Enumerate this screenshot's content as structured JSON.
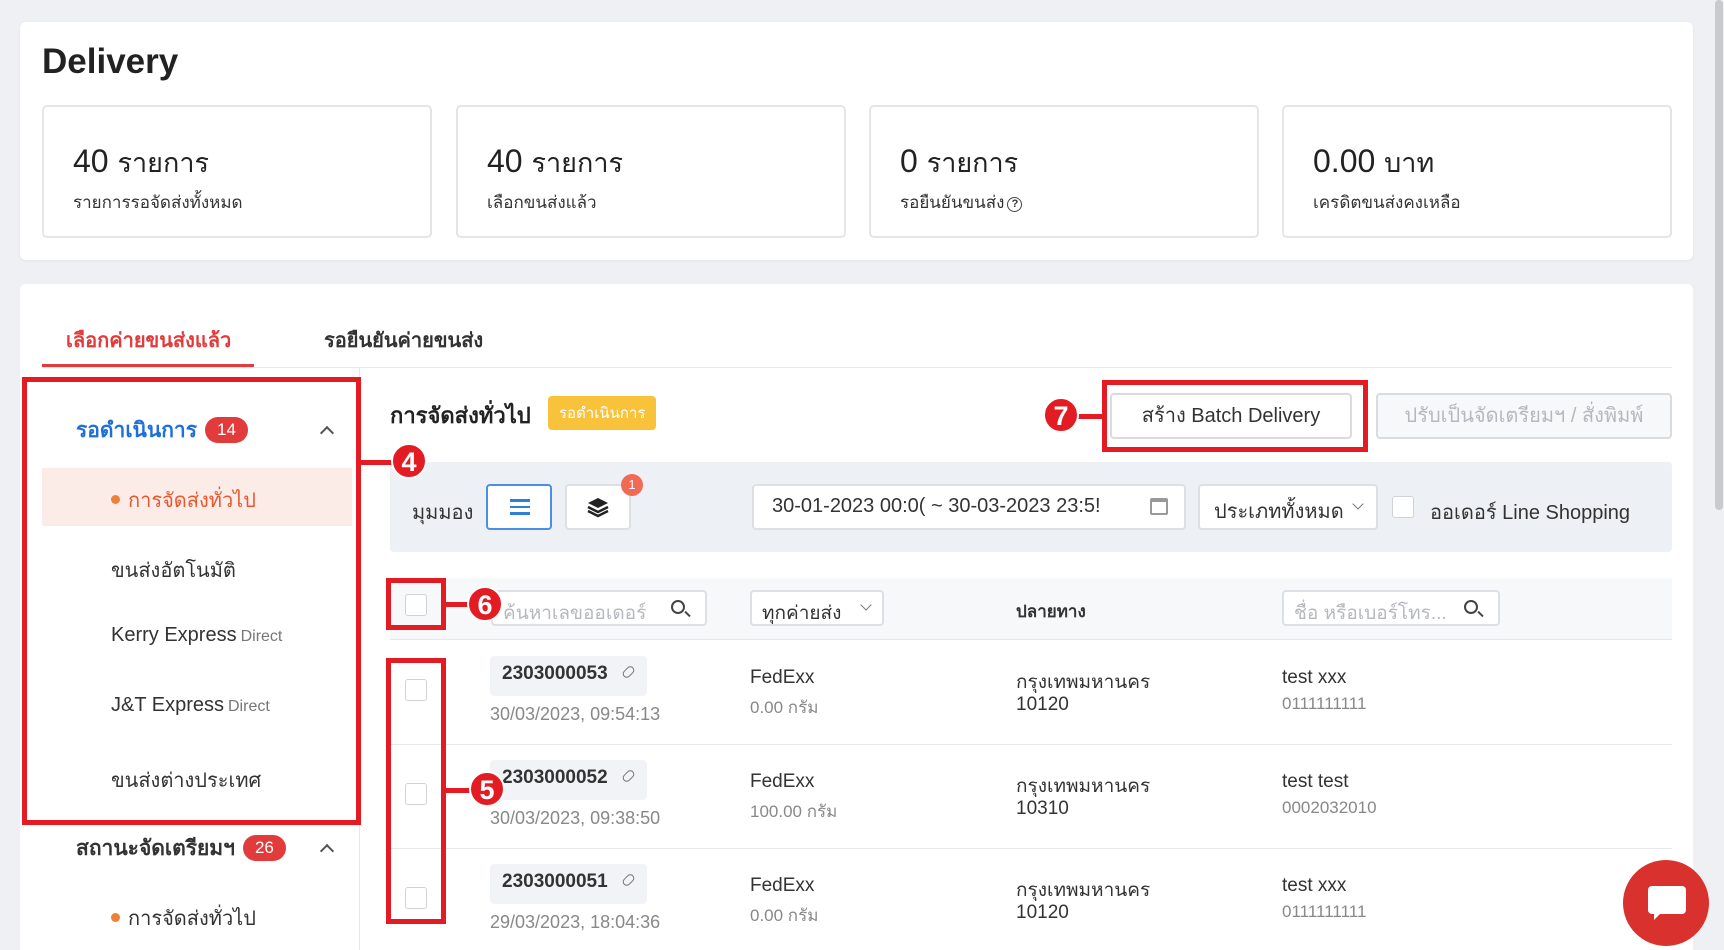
{
  "page": {
    "title": "Delivery"
  },
  "stats": [
    {
      "value": "40",
      "unit": "รายการ",
      "label": "รายการรอจัดส่งทั้งหมด"
    },
    {
      "value": "40",
      "unit": "รายการ",
      "label": "เลือกขนส่งแล้ว"
    },
    {
      "value": "0",
      "unit": "รายการ",
      "label": "รอยืนยันขนส่ง"
    },
    {
      "value": "0.00",
      "unit": "บาท",
      "label": "เครดิตขนส่งคงเหลือ"
    }
  ],
  "tabs": [
    {
      "label": "เลือกค่ายขนส่งแล้ว",
      "active": true
    },
    {
      "label": "รอยืนยันค่ายขนส่ง",
      "active": false
    }
  ],
  "sidebar": {
    "group1": {
      "label": "รอดำเนินการ",
      "count": "14"
    },
    "items": [
      {
        "label": "การจัดส่งทั่วไป",
        "active": true
      },
      {
        "label": "ขนส่งอัตโนมัติ"
      },
      {
        "label": "Kerry Express",
        "suffix": "Direct"
      },
      {
        "label": "J&T Express",
        "suffix": "Direct"
      },
      {
        "label": "ขนส่งต่างประเทศ"
      }
    ],
    "group2": {
      "label": "สถานะจัดเตรียมฯ",
      "count": "26"
    },
    "group2_items": [
      {
        "label": "การจัดส่งทั่วไป"
      }
    ]
  },
  "section": {
    "title": "การจัดส่งทั่วไป",
    "status_badge": "รอดำเนินการ",
    "batch_button": "สร้าง Batch Delivery",
    "adjust_button": "ปรับเป็นจัดเตรียมฯ / สั่งพิมพ์"
  },
  "filters": {
    "view_label": "มุมมอง",
    "layer_notification": "1",
    "date_range": "30-01-2023 00:0( ~ 30-03-2023 23:5!",
    "type_select": "ประเภททั้งหมด",
    "line_shopping_label": "ออเดอร์ Line Shopping"
  },
  "table": {
    "search_order_placeholder": "ค้นหาเลขออเดอร์",
    "carrier_filter": "ทุกค่ายส่ง",
    "destination_header": "ปลายทาง",
    "search_name_placeholder": "ชื่อ หรือเบอร์โทร...",
    "rows": [
      {
        "order_no": "2303000053",
        "timestamp": "30/03/2023, 09:54:13",
        "carrier": "FedExx",
        "weight": "0.00 กรัม",
        "province": "กรุงเทพมหานคร",
        "postcode": "10120",
        "name": "test xxx",
        "phone": "0111111111"
      },
      {
        "order_no": "2303000052",
        "timestamp": "30/03/2023, 09:38:50",
        "carrier": "FedExx",
        "weight": "100.00 กรัม",
        "province": "กรุงเทพมหานคร",
        "postcode": "10310",
        "name": "test test",
        "phone": "0002032010"
      },
      {
        "order_no": "2303000051",
        "timestamp": "29/03/2023, 18:04:36",
        "carrier": "FedExx",
        "weight": "0.00 กรัม",
        "province": "กรุงเทพมหานคร",
        "postcode": "10120",
        "name": "test xxx",
        "phone": "0111111111"
      }
    ]
  },
  "annotations": {
    "n4": "4",
    "n5": "5",
    "n6": "6",
    "n7": "7"
  },
  "colors": {
    "accent": "#e23b3b",
    "primary_blue": "#1e6fd9",
    "warning": "#f8c23a",
    "annotation": "#e31b23"
  },
  "icons": [
    "help-icon",
    "chevron-up-icon",
    "list-view-icon",
    "layers-icon",
    "calendar-icon",
    "chevron-down-icon",
    "search-icon",
    "link-icon",
    "chat-icon"
  ]
}
